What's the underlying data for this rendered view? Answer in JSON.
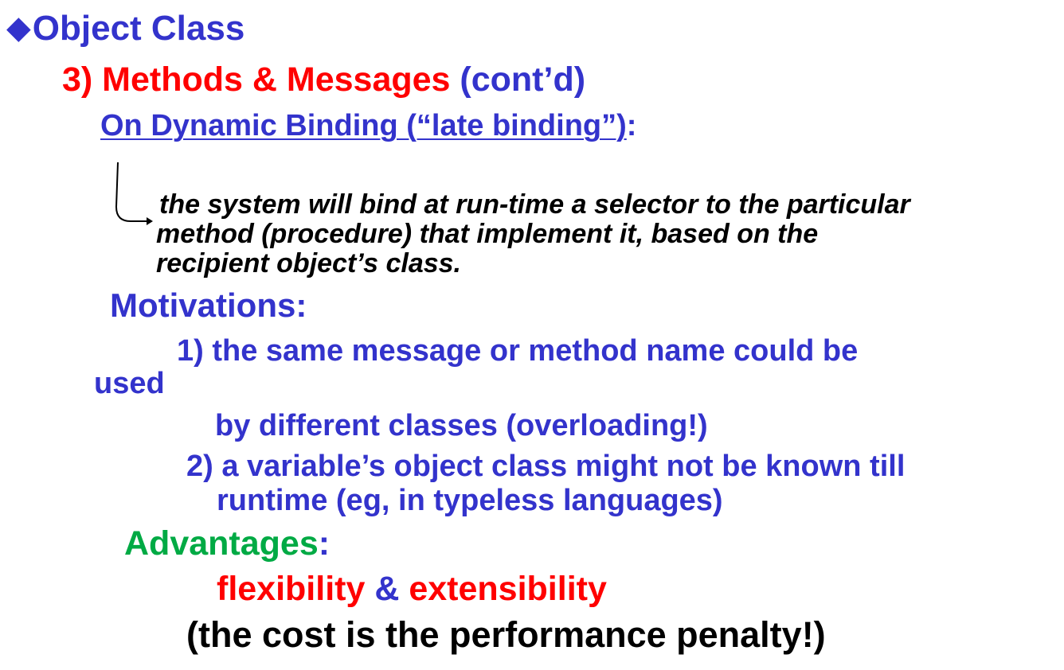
{
  "title": {
    "bullet_icon": "diamond-bullet-icon",
    "text": "Object Class"
  },
  "subheading": {
    "number": "3) Methods & Messages",
    "suffix": " (cont’d)"
  },
  "binding": {
    "underlined": "On Dynamic Binding (“late binding”)",
    "colon": ":"
  },
  "definition": {
    "line1": "the system will bind at run-time a selector to the particular",
    "line2": "method (procedure) that implement it, based on the",
    "line3": "recipient object’s class."
  },
  "motivations": {
    "heading": "Motivations:",
    "item1_line1": "1) the same message or method name could be",
    "item1_line2": "used",
    "item1_line3": "by different classes (overloading!)",
    "item2_line1": "2) a variable’s object class might not be known till",
    "item2_line2": "runtime (eg, in typeless languages)"
  },
  "advantages": {
    "heading": "Advantages",
    "colon": ":",
    "flexibility": "flexibility",
    "amp": " & ",
    "extensibility": "extensibility"
  },
  "cost": {
    "text": "(the cost is the performance penalty!)"
  },
  "colors": {
    "blue": "#3333cc",
    "red": "#ff0000",
    "green": "#00aa44",
    "black": "#000000"
  }
}
